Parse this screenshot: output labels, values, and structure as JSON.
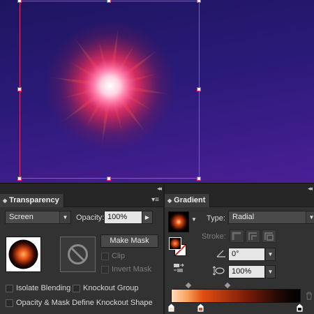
{
  "colors": {
    "canvas_top": "#1e1560",
    "canvas_bottom": "#4a1f96",
    "selection": "#e0396a",
    "panel_bg": "#323232"
  },
  "transparency_panel": {
    "tab_label": "Transparency",
    "blend_mode": "Screen",
    "opacity_label": "Opacity:",
    "opacity_value": "100%",
    "make_mask_label": "Make Mask",
    "clip_label": "Clip",
    "invert_mask_label": "Invert Mask",
    "isolate_blending_label": "Isolate Blending",
    "knockout_group_label": "Knockout Group",
    "opacity_mask_label": "Opacity & Mask Define Knockout Shape"
  },
  "gradient_panel": {
    "tab_label": "Gradient",
    "type_label": "Type:",
    "type_value": "Radial",
    "stroke_label": "Stroke:",
    "angle_value": "0°",
    "aspect_value": "100%"
  },
  "icons": [
    "menu-icon",
    "collapse-icon",
    "no-mask-icon",
    "angle-icon",
    "aspect-ratio-icon",
    "reverse-gradient-icon",
    "trash-icon"
  ]
}
